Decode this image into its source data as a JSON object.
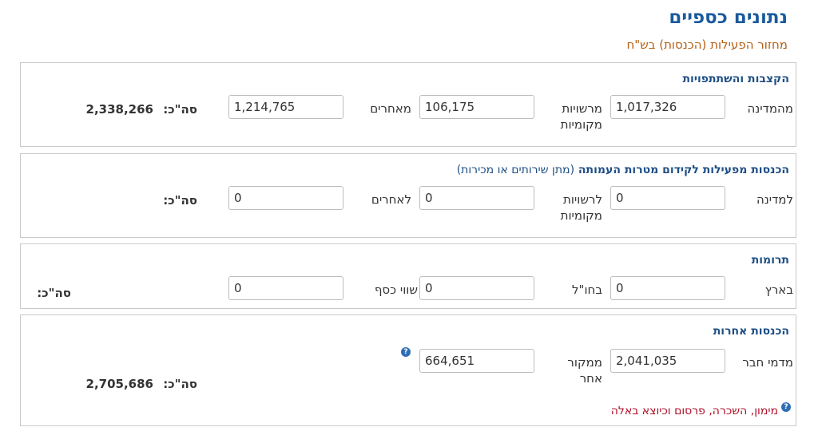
{
  "title": "נתונים כספיים",
  "subtitle": "מחזור הפעילות (הכנסות) בש\"ח",
  "total_label": "סה\"כ:",
  "help_glyph": "?",
  "sections": [
    {
      "title": "הקצבות והשתתפויות",
      "fields": [
        {
          "label": "מהמדינה",
          "value": "1,017,326"
        },
        {
          "label": "מרשויות מקומיות",
          "value": "106,175"
        },
        {
          "label": "מאחרים",
          "value": "1,214,765"
        }
      ],
      "total": "2,338,266"
    },
    {
      "title": "הכנסות מפעילות לקידום מטרות העמותה",
      "title_note": "(מתן שירותים או מכירות)",
      "fields": [
        {
          "label": "למדינה",
          "value": "0"
        },
        {
          "label": "לרשויות מקומיות",
          "value": "0"
        },
        {
          "label": "לאחרים",
          "value": "0"
        }
      ],
      "total": ""
    },
    {
      "title": "תרומות",
      "fields": [
        {
          "label": "בארץ",
          "value": "0"
        },
        {
          "label": "בחו\"ל",
          "value": "0"
        },
        {
          "label": "שווי כסף",
          "value": "0"
        }
      ],
      "total": ""
    },
    {
      "title": "הכנסות אחרות",
      "fields": [
        {
          "label": "מדמי חבר",
          "value": "2,041,035"
        },
        {
          "label": "ממקור אחר",
          "value": "664,651"
        }
      ],
      "total": "2,705,686",
      "link_text": "מימון, השכרה, פרסום וכיוצא באלה"
    }
  ]
}
